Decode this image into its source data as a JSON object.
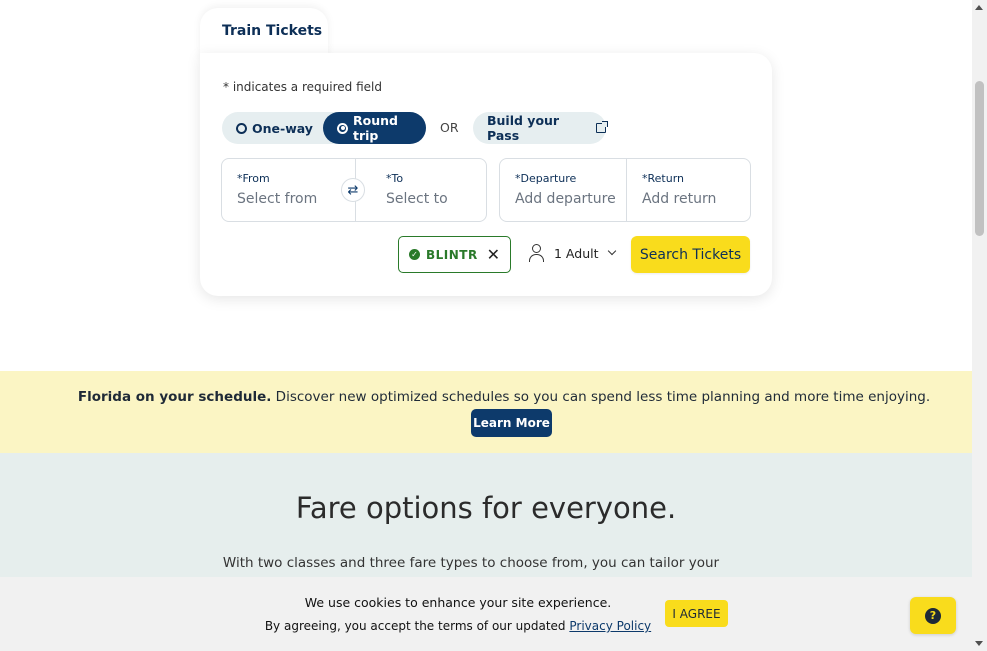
{
  "widget": {
    "tab_label": "Train Tickets",
    "required_note": "* indicates a required field",
    "trip_types": {
      "one_way": "One-way",
      "round_trip": "Round trip",
      "selected": "Round trip"
    },
    "or_text": "OR",
    "build_pass": "Build your Pass",
    "from": {
      "label": "*From",
      "placeholder": "Select from"
    },
    "to": {
      "label": "*To",
      "placeholder": "Select to"
    },
    "departure": {
      "label": "*Departure",
      "placeholder": "Add departure"
    },
    "return": {
      "label": "*Return",
      "placeholder": "Add return"
    },
    "promo_code": "BLINTR",
    "passengers": "1 Adult",
    "search_button": "Search Tickets"
  },
  "banner": {
    "bold_text": "Florida on your schedule.",
    "text": " Discover new optimized schedules so you can spend less time planning and more time enjoying.",
    "button": "Learn More"
  },
  "fare_section": {
    "heading": "Fare options for everyone.",
    "text": "With two classes and three fare types to choose from, you can tailor your"
  },
  "cookie_bar": {
    "line1": "We use cookies to enhance your site experience.",
    "line2_prefix": "By agreeing, you accept the terms of our updated ",
    "link": "Privacy Policy",
    "agree_button": "I AGREE"
  },
  "colors": {
    "navy": "#0d3a6b",
    "yellow": "#f9dc1c",
    "banner_bg": "#fbf5c4",
    "section_bg": "#e6eeed",
    "promo_green": "#2a7a2a"
  },
  "icons": [
    "swap-icon",
    "external-link-icon",
    "check-circle-icon",
    "close-icon",
    "person-icon",
    "chevron-down-icon",
    "help-icon"
  ]
}
